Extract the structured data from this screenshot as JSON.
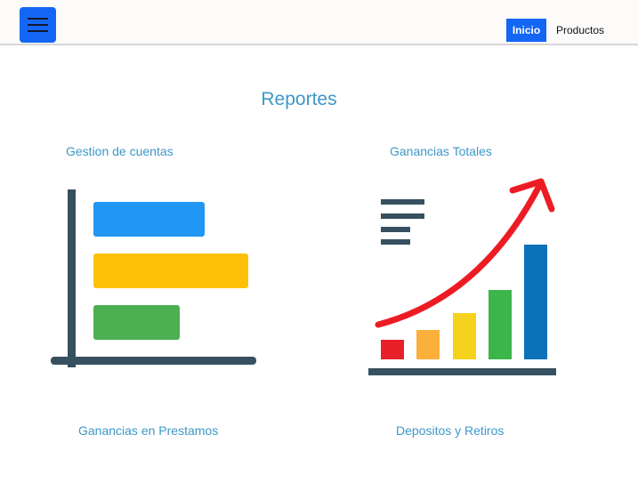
{
  "navbar": {
    "menu_icon": "hamburger-icon",
    "links": [
      "Inicio",
      "Productos"
    ],
    "brand_color": "#1466f5"
  },
  "main": {
    "title": "Reportes",
    "reports": [
      {
        "label": "Gestion de cuentas",
        "icon": "horizontal-bar-chart-icon"
      },
      {
        "label": "Ganancias Totales",
        "icon": "growth-bar-chart-icon"
      },
      {
        "label": "Ganancias en Prestamos"
      },
      {
        "label": "Depositos y Retiros"
      }
    ]
  }
}
